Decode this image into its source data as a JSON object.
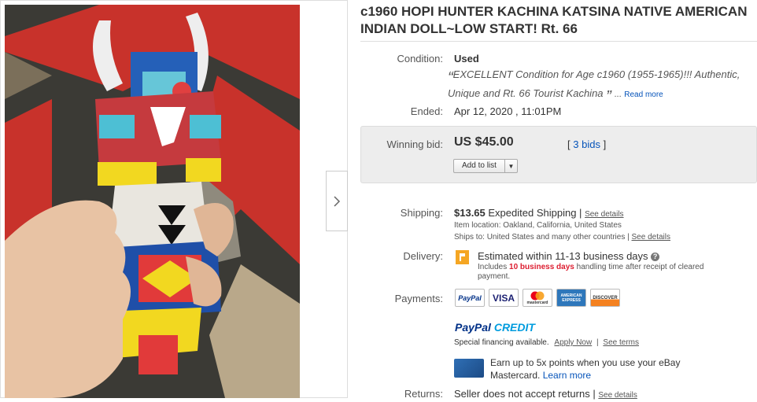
{
  "title": "c1960 HOPI HUNTER KACHINA KATSINA NATIVE AMERICAN INDIAN DOLL~LOW START! Rt. 66",
  "condition": {
    "label": "Condition:",
    "value": "Used",
    "description_line1": "EXCELLENT Condition for Age c1960 (1955-1965)!!! Authentic,",
    "description_line2": "Unique and Rt. 66 Tourist Kachina",
    "open_quote": "“",
    "close_quote": "”",
    "ellipsis": "...",
    "read_more": "Read more"
  },
  "ended": {
    "label": "Ended:",
    "value": "Apr 12, 2020 , 11:01PM"
  },
  "winning_bid": {
    "label": "Winning bid:",
    "value": "US $45.00",
    "bids_open": "[",
    "bids_link": "3 bids",
    "bids_close": "]",
    "add_to_list": "Add to list",
    "dropdown_arrow": "▼"
  },
  "shipping": {
    "label": "Shipping:",
    "cost": "$13.65",
    "method": "Expedited Shipping",
    "separator": "|",
    "see_details": "See details",
    "item_location": "Item location:  Oakland, California, United States",
    "ships_to": "Ships to:  United States and many other countries",
    "ships_to_sep": "|",
    "ships_to_details": "See details"
  },
  "delivery": {
    "label": "Delivery:",
    "estimate": "Estimated within 11-13 business days",
    "help": "?",
    "note_prefix": "Includes",
    "note_highlight": "10 business days",
    "note_suffix": "handling time after receipt of cleared",
    "note_line2": "payment."
  },
  "payments": {
    "label": "Payments:",
    "logos": [
      "PayPal",
      "VISA",
      "mastercard",
      "AMERICAN EXPRESS",
      "DISCOVER"
    ],
    "paypal_credit_1": "PayPal",
    "paypal_credit_2": "CREDIT",
    "financing": "Special financing available.",
    "apply_now": "Apply Now",
    "sep": "|",
    "see_terms": "See terms",
    "card_promo_line1": "Earn up to 5x points when you use your eBay",
    "card_promo_line2": "Mastercard.",
    "learn_more": "Learn more"
  },
  "returns": {
    "label": "Returns:",
    "value": "Seller does not accept returns",
    "sep": "|",
    "see_details": "See details"
  },
  "colors": {
    "link": "#0654ba",
    "highlight": "#dd1e31",
    "flag": "#f5a623",
    "paypal_dark": "#003087",
    "paypal_light": "#009cde"
  }
}
